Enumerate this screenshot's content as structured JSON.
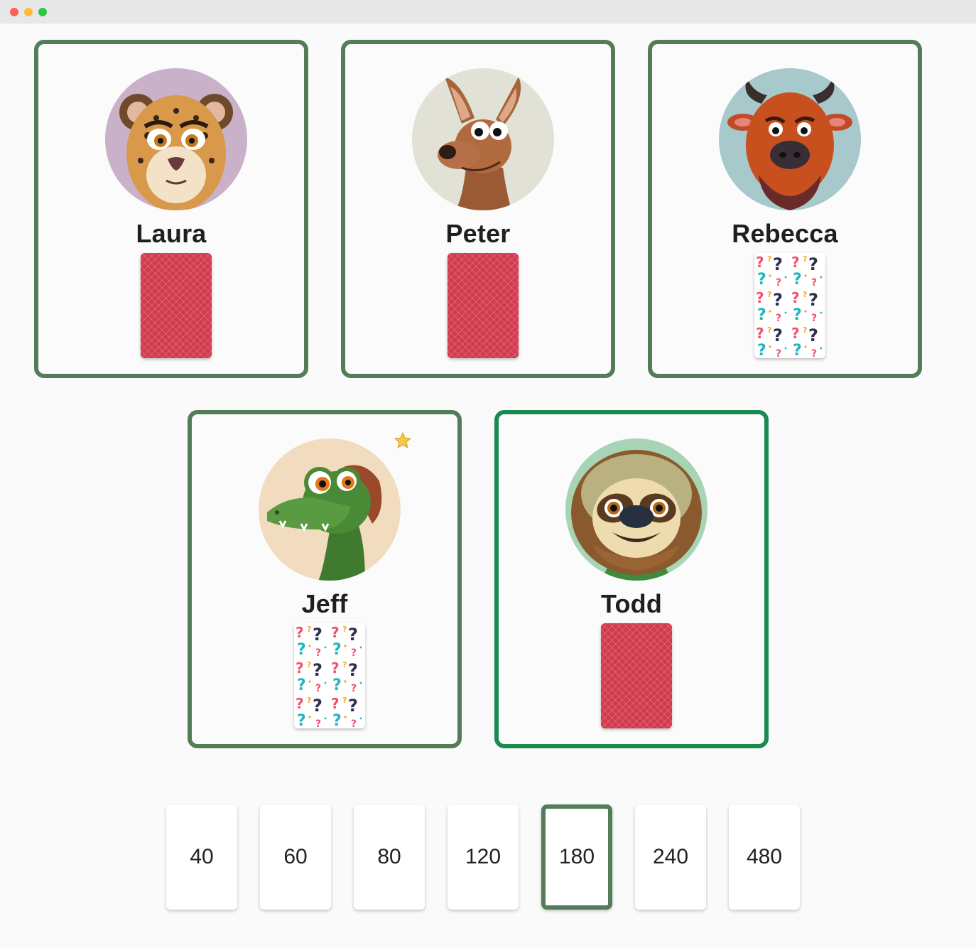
{
  "window": {
    "controls": [
      "close",
      "minimize",
      "maximize"
    ]
  },
  "colors": {
    "player_border": "#537c58",
    "active_border": "#1b8a4f",
    "card_back": "#d23a4d"
  },
  "players": [
    {
      "name": "Laura",
      "avatar": "leopard-avatar",
      "card": "face-down"
    },
    {
      "name": "Peter",
      "avatar": "kangaroo-avatar",
      "card": "face-down"
    },
    {
      "name": "Rebecca",
      "avatar": "bison-avatar",
      "card": "question-marks"
    },
    {
      "name": "Jeff",
      "avatar": "crocodile-avatar",
      "card": "question-marks",
      "badge": "star-icon"
    },
    {
      "name": "Todd",
      "avatar": "sloth-avatar",
      "card": "face-down",
      "active": true
    }
  ],
  "vote_cards": [
    "40",
    "60",
    "80",
    "120",
    "180",
    "240",
    "480"
  ],
  "selected_vote": "180"
}
